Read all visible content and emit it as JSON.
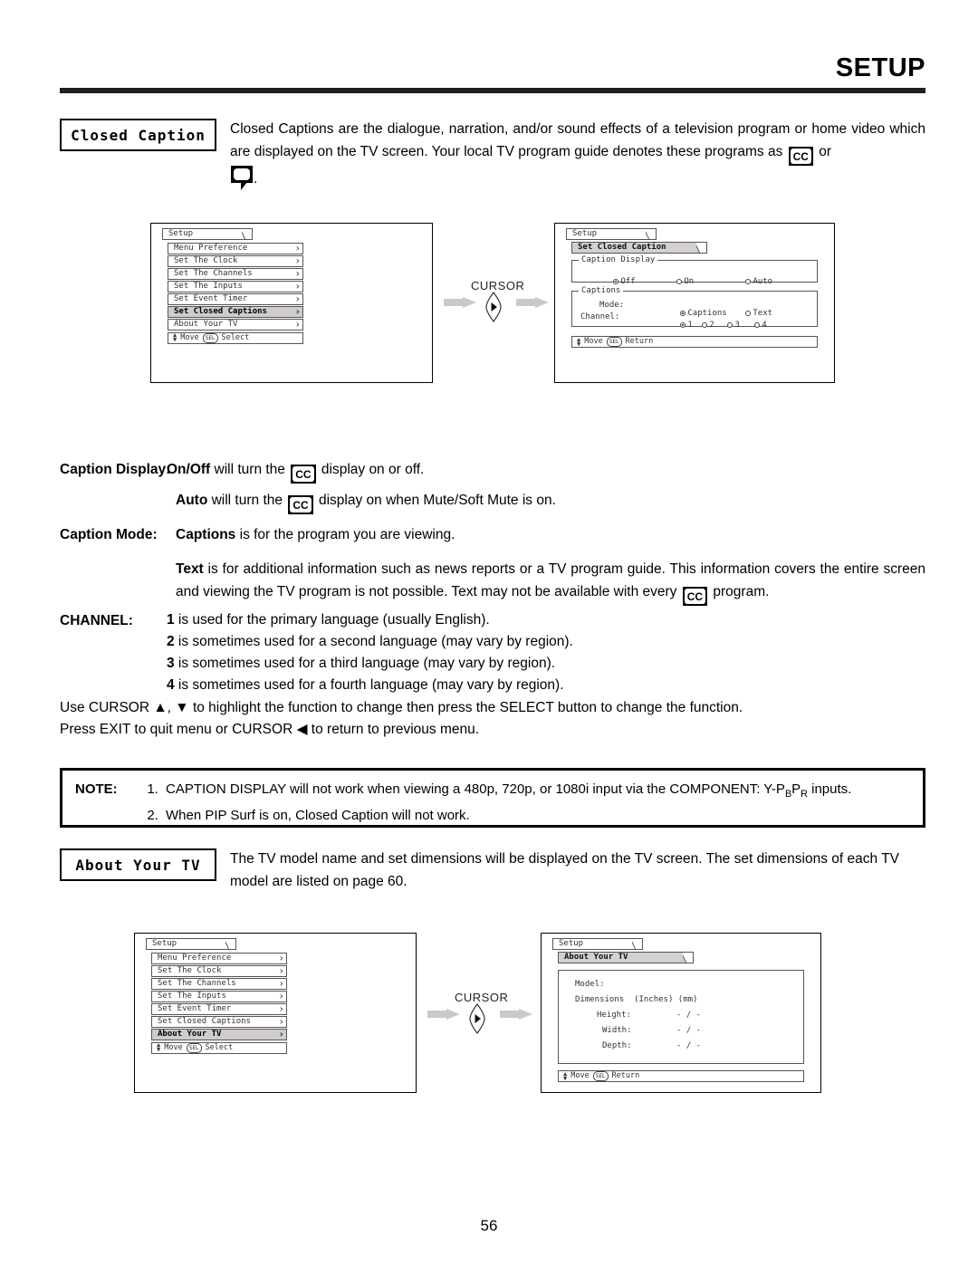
{
  "header": {
    "title": "SETUP"
  },
  "page_number": "56",
  "sections": {
    "closed_caption": {
      "label": "Closed Caption",
      "intro_part1": "Closed Captions are the dialogue, narration, and/or sound effects of a television program or home video which are displayed on the TV screen.  Your local TV program guide denotes these programs as ",
      "cc_icon_text": "CC",
      "intro_or": " or",
      "intro_period": "."
    },
    "about_your_tv": {
      "label": "About Your TV",
      "text": "The TV model name and set dimensions will be displayed on the TV screen.  The set dimensions of each TV model are listed on page 60."
    }
  },
  "definitions": {
    "caption_display": {
      "term": "Caption Display:",
      "bold_lead": "On/Off",
      "text_after": " will turn the ",
      "text_end": " display on or off."
    },
    "auto": {
      "bold_lead": "Auto",
      "text_after": " will turn the ",
      "text_end": " display on when Mute/Soft Mute is on."
    },
    "caption_mode": {
      "term": "Caption Mode:",
      "bold_lead": "Captions",
      "text_after": " is for the program you are viewing."
    },
    "text_mode": {
      "bold_lead": "Text",
      "text_after": " is for additional information such as news reports or a TV program guide.  This information covers the entire screen and viewing the TV program is not possible.  Text may not be available with every ",
      "text_end": " program."
    },
    "channel": {
      "term": "CHANNEL:",
      "lines": [
        {
          "num": "1",
          "text": " is used for the primary language (usually English)."
        },
        {
          "num": "2",
          "text": " is sometimes used for a second language (may vary by region)."
        },
        {
          "num": "3",
          "text": " is sometimes used for a third language (may vary by region)."
        },
        {
          "num": "4",
          "text": " is sometimes used for a fourth language (may vary by region)."
        }
      ]
    }
  },
  "instructions": {
    "line1": "Use CURSOR ▲, ▼ to highlight the function to change then press the SELECT button to change the function.",
    "line2_pre": "Press EXIT to quit menu or CURSOR ",
    "line2_arrow": "◀",
    "line2_post": " to return to previous menu."
  },
  "note": {
    "label": "NOTE:",
    "item1_pre": "CAPTION DISPLAY will not work when viewing a 480p, 720p, or 1080i input via the COMPONENT: Y-P",
    "item1_sub1": "B",
    "item1_mid": "P",
    "item1_sub2": "R",
    "item1_post": " inputs.",
    "item2": "When PIP Surf is on, Closed Caption will not work."
  },
  "cursor": {
    "label": "CURSOR"
  },
  "osd": {
    "setup_menu_1": {
      "tab": "Setup",
      "items": [
        {
          "label": "Menu Preference",
          "selected": false
        },
        {
          "label": "Set The Clock",
          "selected": false
        },
        {
          "label": "Set The Channels",
          "selected": false
        },
        {
          "label": "Set The Inputs",
          "selected": false
        },
        {
          "label": "Set Event Timer",
          "selected": false
        },
        {
          "label": "Set Closed Captions",
          "selected": true
        },
        {
          "label": "About Your TV",
          "selected": false
        }
      ],
      "footer_move": "Move",
      "footer_key": "SEL",
      "footer_action": "Select"
    },
    "setup_menu_2": {
      "tab": "Setup",
      "items": [
        {
          "label": "Menu Preference",
          "selected": false
        },
        {
          "label": "Set The Clock",
          "selected": false
        },
        {
          "label": "Set The Channels",
          "selected": false
        },
        {
          "label": "Set The Inputs",
          "selected": false
        },
        {
          "label": "Set Event Timer",
          "selected": false
        },
        {
          "label": "Set Closed Captions",
          "selected": false
        },
        {
          "label": "About Your TV",
          "selected": true
        }
      ],
      "footer_move": "Move",
      "footer_key": "SEL",
      "footer_action": "Select"
    },
    "closed_caption_panel": {
      "tab": "Setup",
      "subtab": "Set Closed Caption",
      "group1_legend": "Caption Display",
      "group1_options": [
        {
          "label": "Off",
          "selected": true
        },
        {
          "label": "On",
          "selected": false
        },
        {
          "label": "Auto",
          "selected": false
        }
      ],
      "group2_legend": "Captions",
      "mode_label": "Mode:",
      "mode_options": [
        {
          "label": "Captions",
          "selected": true
        },
        {
          "label": "Text",
          "selected": false
        }
      ],
      "channel_label": "Channel:",
      "channel_options": [
        {
          "label": "1",
          "selected": true
        },
        {
          "label": "2",
          "selected": false
        },
        {
          "label": "3",
          "selected": false
        },
        {
          "label": "4",
          "selected": false
        }
      ],
      "footer_move": "Move",
      "footer_key": "SEL",
      "footer_action": "Return"
    },
    "about_tv_panel": {
      "tab": "Setup",
      "subtab": "About Your TV",
      "model_label": "Model:",
      "dimensions_label": "Dimensions  (Inches) (mm)",
      "rows": [
        {
          "label": "Height:",
          "value": "- / -"
        },
        {
          "label": "Width:",
          "value": "- / -"
        },
        {
          "label": "Depth:",
          "value": "- / -"
        }
      ],
      "footer_move": "Move",
      "footer_key": "SEL",
      "footer_action": "Return"
    }
  }
}
